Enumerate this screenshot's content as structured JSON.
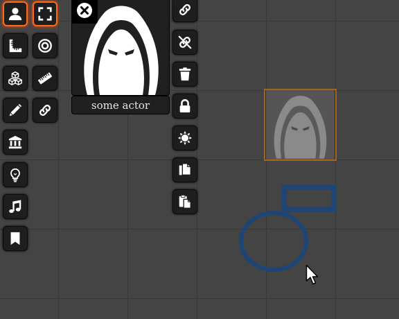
{
  "hud": {
    "actor_name": "some actor",
    "close_icon": "close-icon",
    "portrait_icon": "hooded-figure-icon"
  },
  "left_toolbar": [
    {
      "name": "token-controls-button",
      "icon": "person-icon",
      "active": true
    },
    {
      "name": "select-targets-button",
      "icon": "expand-icon",
      "active": true
    },
    {
      "name": "measure-button",
      "icon": "ruler-square-icon"
    },
    {
      "name": "target-button",
      "icon": "target-icon"
    },
    {
      "name": "tiles-button",
      "icon": "cubes-icon"
    },
    {
      "name": "ruler-button",
      "icon": "ruler-icon"
    },
    {
      "name": "drawing-button",
      "icon": "pencil-icon"
    },
    {
      "name": "links-button",
      "icon": "link-icon"
    },
    {
      "name": "walls-button",
      "icon": "building-icon"
    },
    {
      "name": "lighting-button",
      "icon": "lightbulb-icon"
    },
    {
      "name": "sounds-button",
      "icon": "music-icon"
    },
    {
      "name": "notes-button",
      "icon": "bookmark-icon"
    }
  ],
  "right_toolbar": [
    {
      "name": "link-button",
      "icon": "link-icon"
    },
    {
      "name": "unlink-button",
      "icon": "unlink-icon"
    },
    {
      "name": "delete-button",
      "icon": "trash-icon"
    },
    {
      "name": "lock-button",
      "icon": "lock-icon"
    },
    {
      "name": "configure-button",
      "icon": "gear-sun-icon"
    },
    {
      "name": "copy-button",
      "icon": "copy-icon"
    },
    {
      "name": "paste-button",
      "icon": "paste-icon"
    }
  ],
  "colors": {
    "canvas": "#444444",
    "grid": "#383838",
    "active_border": "#ff6a1a",
    "token_border": "#a8631d",
    "shape_stroke": "#1d4577"
  }
}
